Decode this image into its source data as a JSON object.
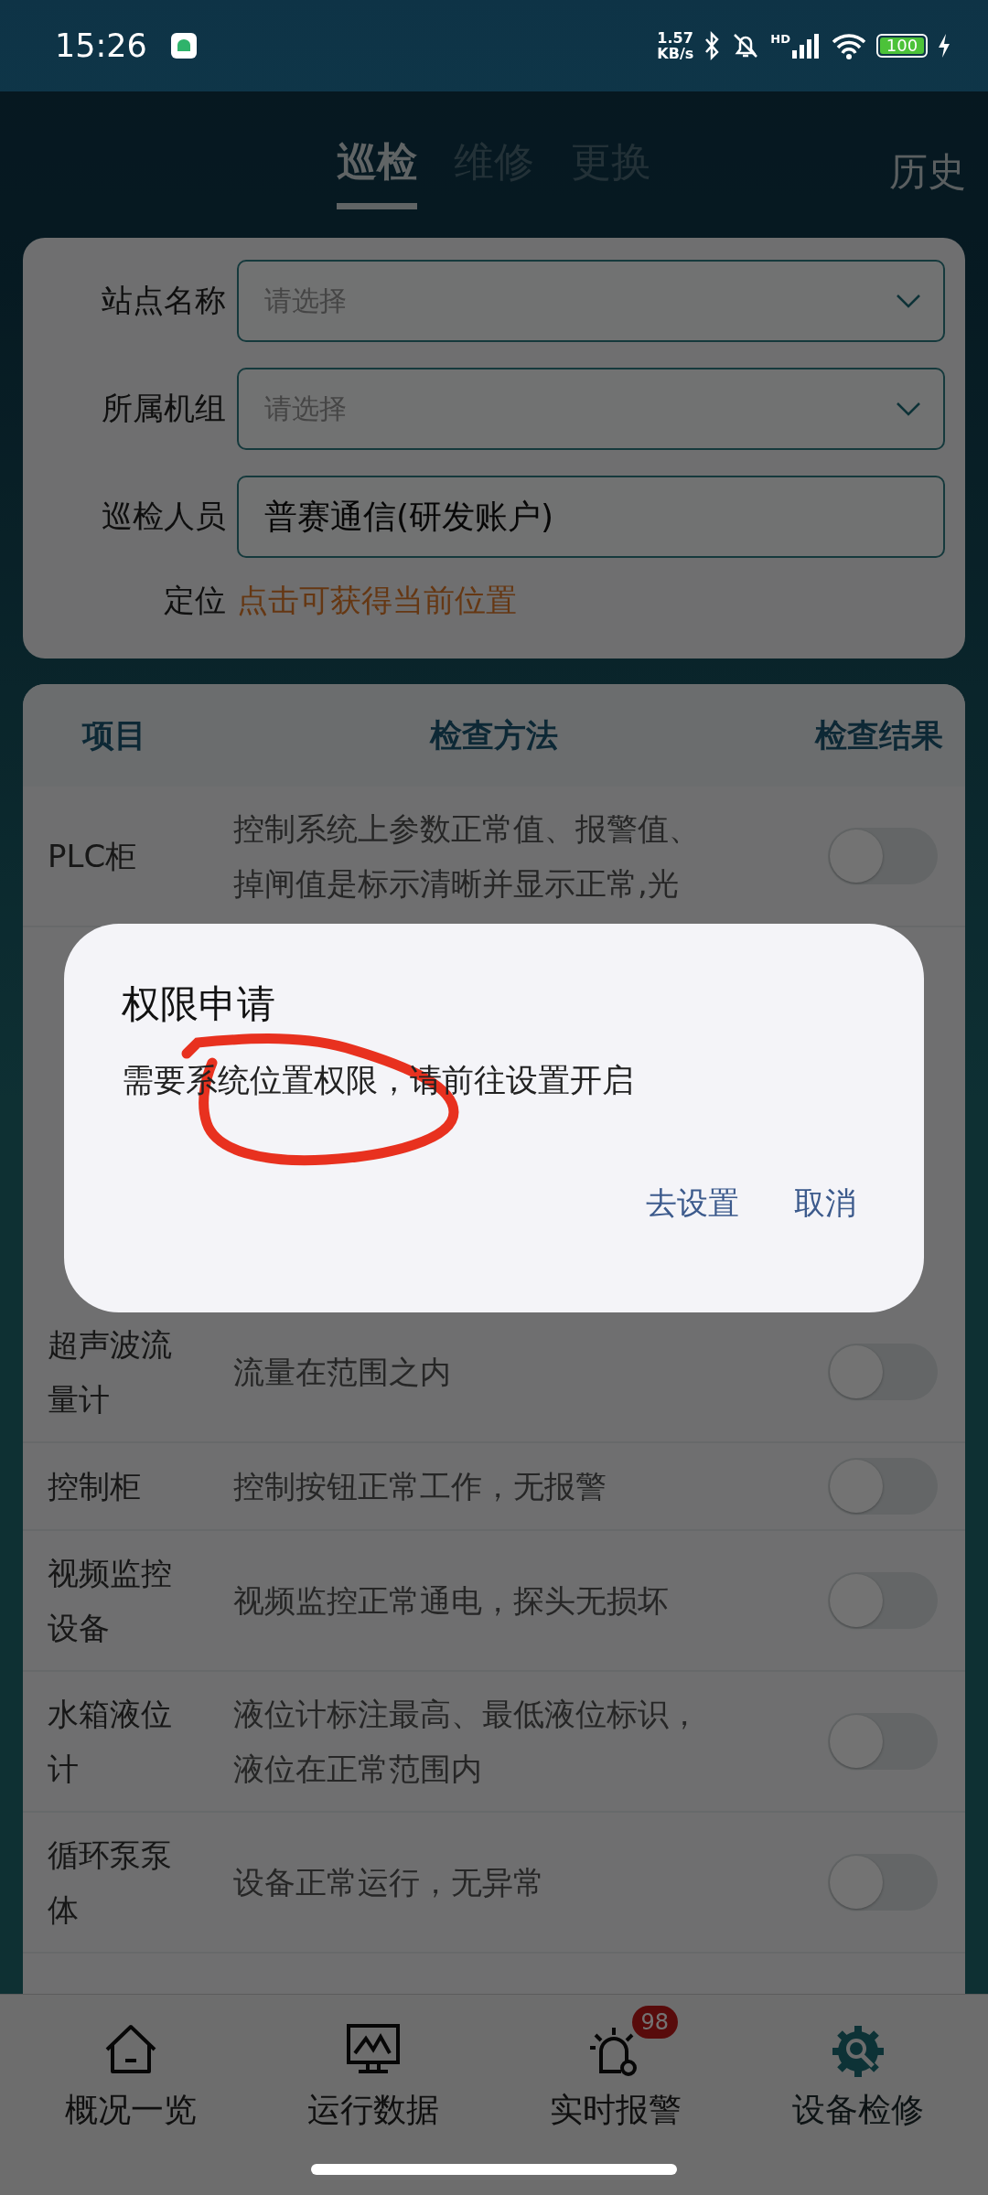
{
  "status_bar": {
    "time": "15:26",
    "speed": "1.57",
    "speed_unit": "KB/s",
    "network": "HD",
    "battery": "100"
  },
  "tabs": [
    {
      "label": "巡检",
      "selected": true
    },
    {
      "label": "维修",
      "selected": false
    },
    {
      "label": "更换",
      "selected": false
    }
  ],
  "history_link": "历史",
  "form": {
    "fields": [
      {
        "label": "站点名称",
        "kind": "select",
        "placeholder": "请选择"
      },
      {
        "label": "所属机组",
        "kind": "select",
        "placeholder": "请选择"
      },
      {
        "label": "巡检人员",
        "kind": "text",
        "value": "普赛通信(研发账户)"
      }
    ],
    "location": {
      "label": "定位",
      "link": "点击可获得当前位置"
    }
  },
  "table": {
    "columns": [
      "项目",
      "检查方法",
      "检查结果"
    ],
    "rows": [
      {
        "item": "PLC柜",
        "method": "控制系统上参数正常值、报警值、掉闸值是标示清晰并显示正常,光",
        "on": false
      },
      {
        "item": "超声波流量计",
        "method": "流量在范围之内",
        "on": false
      },
      {
        "item": "控制柜",
        "method": "控制按钮正常工作，无报警",
        "on": false
      },
      {
        "item": "视频监控设备",
        "method": "视频监控正常通电，探头无损坏",
        "on": false
      },
      {
        "item": "水箱液位计",
        "method": "液位计标注最高、最低液位标识，液位在正常范围内",
        "on": false
      },
      {
        "item": "循环泵泵体",
        "method": "设备正常运行，无异常",
        "on": false
      }
    ]
  },
  "dialog": {
    "title": "权限申请",
    "message": "需要系统位置权限，请前往设置开启",
    "buttons": [
      "去设置",
      "取消"
    ]
  },
  "bottom_nav": [
    {
      "label": "概况一览",
      "selected": false
    },
    {
      "label": "运行数据",
      "selected": false
    },
    {
      "label": "实时报警",
      "selected": false,
      "badge": "98"
    },
    {
      "label": "设备检修",
      "selected": true
    }
  ]
}
